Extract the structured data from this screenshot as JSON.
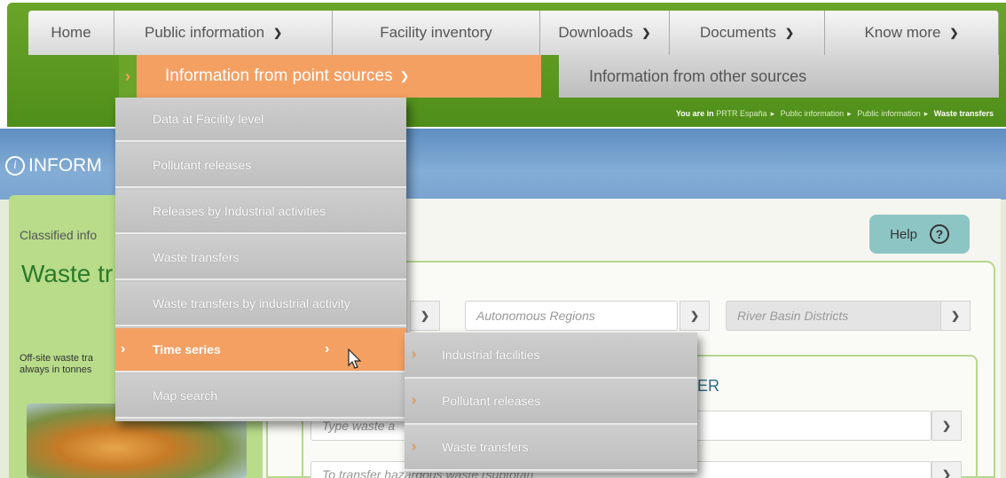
{
  "nav": {
    "home": "Home",
    "public_info": "Public information",
    "facility_inventory": "Facility inventory",
    "downloads": "Downloads",
    "documents": "Documents",
    "know_more": "Know more"
  },
  "subnav": {
    "point_sources": "Information from point sources",
    "other_sources": "Information from other sources"
  },
  "breadcrumb": {
    "prefix": "You are in",
    "items": [
      "PRTR España",
      "Public information",
      "Public information"
    ],
    "current": "Waste transfers"
  },
  "banner": {
    "title": "INFORM"
  },
  "left_panel": {
    "classified": "Classified info",
    "title": "Waste tr",
    "description": "Off-site waste tra always in tonnes"
  },
  "help": {
    "label": "Help",
    "icon": "?"
  },
  "filters": {
    "autonomous_regions": "Autonomous Regions",
    "river_basin": "River Basin Districts",
    "waste_type": "Type waste a",
    "hazardous": "To transfer hazardous waste (subtotal)"
  },
  "inner_heading": "ER",
  "dropdown": {
    "items": [
      "Data at Facility level",
      "Pollutant releases",
      "Releases by Industrial activities",
      "Waste transfers",
      "Waste transfers by industrial activity",
      "Time series",
      "Map search"
    ]
  },
  "submenu": {
    "items": [
      "Industrial facilities",
      "Pollutant releases",
      "Waste transfers"
    ]
  },
  "icons": {
    "chevron_down": "chevron-down-icon",
    "chevron_right": "chevron-right-icon",
    "info": "info-icon",
    "help": "question-icon",
    "cursor": "mouse-pointer-icon"
  },
  "colors": {
    "brand_green": "#5a9a22",
    "accent_orange": "#f4a063",
    "menu_gray": "#c6c6c6",
    "help_teal": "#8dc5c4"
  }
}
